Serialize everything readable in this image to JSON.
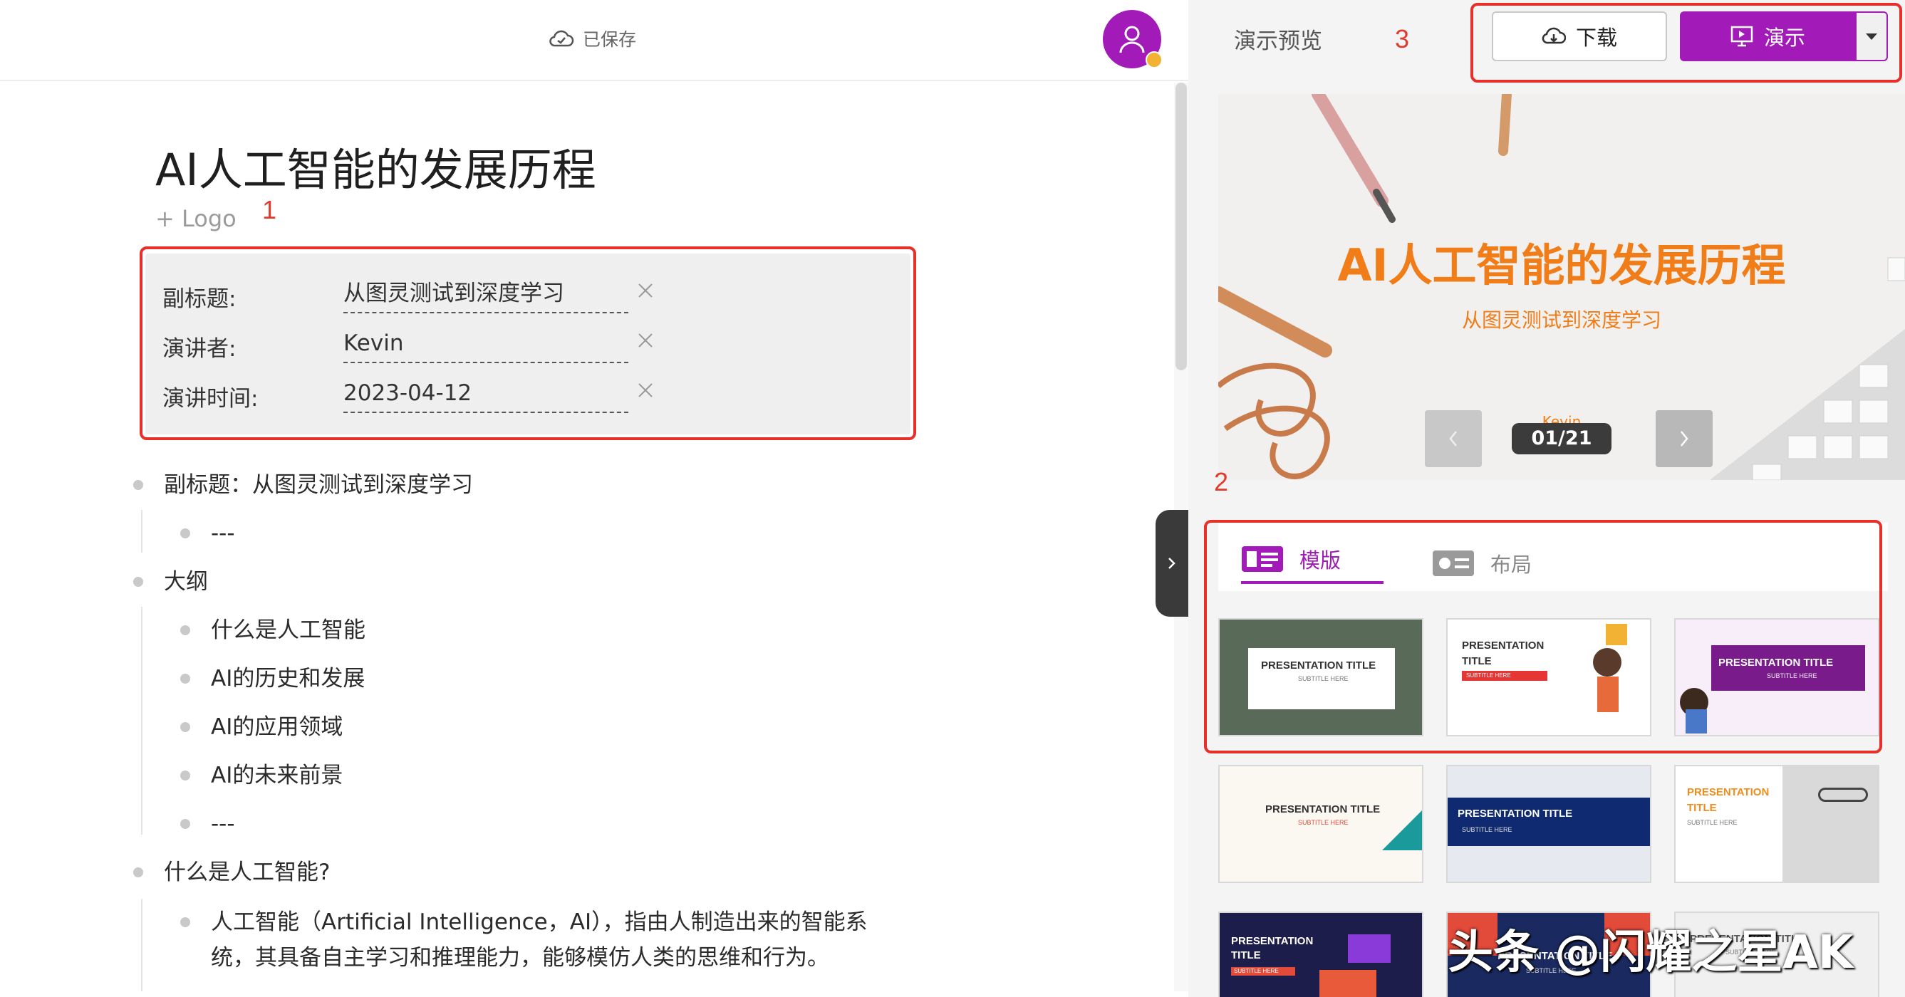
{
  "editor": {
    "saved_status": "已保存",
    "title": "AI人工智能的发展历程",
    "add_logo": "+ Logo",
    "meta": [
      {
        "label": "副标题:",
        "value": "从图灵测试到深度学习"
      },
      {
        "label": "演讲者:",
        "value": "Kevin"
      },
      {
        "label": "演讲时间:",
        "value": "2023-04-12"
      }
    ],
    "outline": [
      {
        "level": 1,
        "text": "副标题：从图灵测试到深度学习"
      },
      {
        "level": 2,
        "text": "---"
      },
      {
        "level": 1,
        "text": "大纲"
      },
      {
        "level": 2,
        "text": "什么是人工智能"
      },
      {
        "level": 2,
        "text": "AI的历史和发展"
      },
      {
        "level": 2,
        "text": "AI的应用领域"
      },
      {
        "level": 2,
        "text": "AI的未来前景"
      },
      {
        "level": 2,
        "text": "---"
      },
      {
        "level": 1,
        "text": "什么是人工智能?"
      },
      {
        "level": 2,
        "text": "人工智能（Artificial Intelligence，AI），指由人制造出来的智能系",
        "cont": "统，其具备自主学习和推理能力，能够模仿人类的思维和行为。"
      }
    ]
  },
  "markers": {
    "one": "1",
    "two": "2",
    "three": "3"
  },
  "preview": {
    "label": "演示预览",
    "download": "下载",
    "present": "演示",
    "slide": {
      "title": "AI人工智能的发展历程",
      "subtitle": "从图灵测试到深度学习",
      "speaker": "Kevin",
      "counter": "01/21"
    },
    "tabs": {
      "template": "模版",
      "layout": "布局"
    },
    "templates": [
      {
        "title": "PRESENTATION TITLE",
        "sub": "SUBTITLE HERE"
      },
      {
        "title": "PRESENTATION TITLE",
        "sub": "SUBTITLE HERE"
      },
      {
        "title": "PRESENTATION TITLE",
        "sub": "SUBTITLE HERE"
      },
      {
        "title": "PRESENTATION TITLE",
        "sub": "SUBTITLE HERE"
      },
      {
        "title": "PRESENTATION TITLE",
        "sub": "SUBTITLE HERE"
      },
      {
        "title": "PRESENTATION TITLE",
        "sub": "SUBTITLE HERE"
      },
      {
        "title": "PRESENTATION TITLE",
        "sub": "SUBTITLE HERE"
      },
      {
        "title": "PRESENTATION TITLE",
        "sub": "SUBTITLE HERE"
      },
      {
        "title": "PRESENTATION TITLE",
        "sub": "SUBTITLE HERE"
      }
    ]
  },
  "watermark": "头条 @闪耀之星AK",
  "colors": {
    "accent": "#a21ab8",
    "slide_text": "#f07d17",
    "annotation": "#e8302a"
  }
}
